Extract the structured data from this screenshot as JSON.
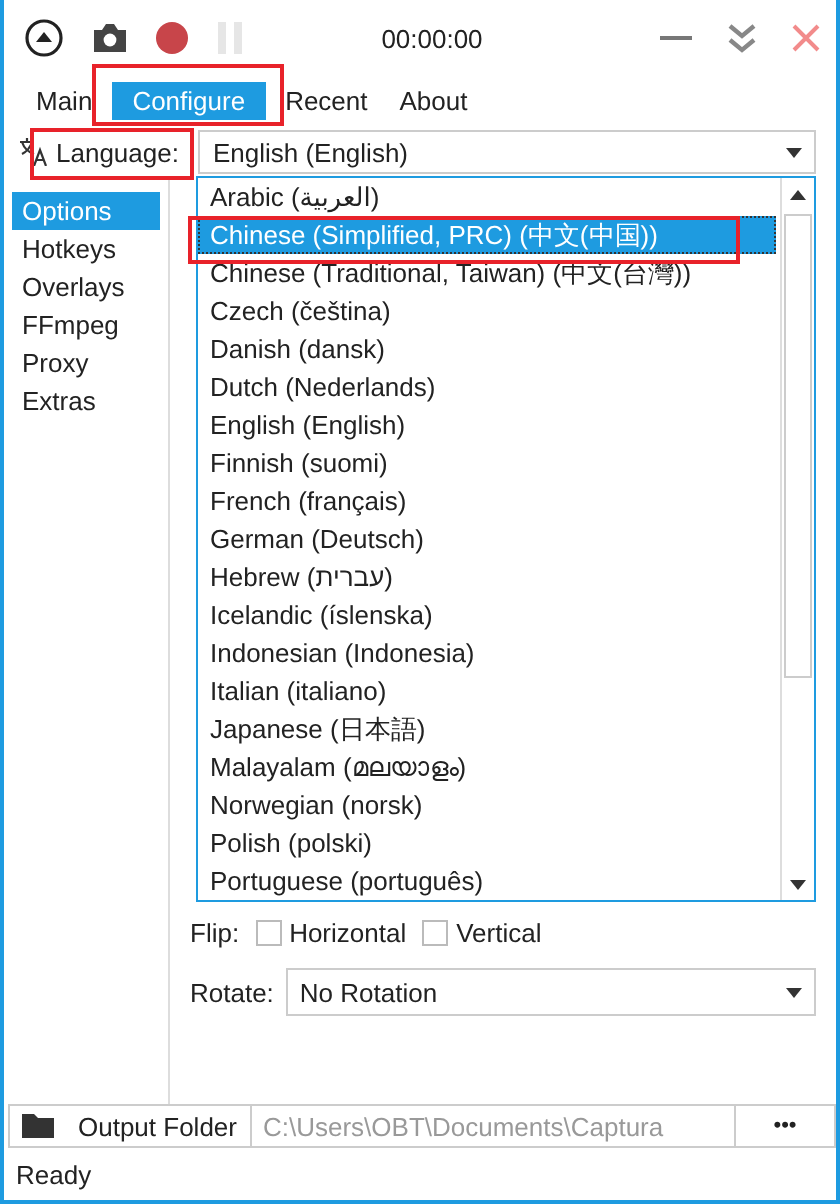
{
  "toolbar": {
    "time": "00:00:00"
  },
  "tabs": [
    {
      "label": "Main",
      "selected": false
    },
    {
      "label": "Configure",
      "selected": true
    },
    {
      "label": "Recent",
      "selected": false
    },
    {
      "label": "About",
      "selected": false
    }
  ],
  "language": {
    "label": "Language:",
    "value": "English (English)",
    "options": [
      {
        "label": "Arabic (العربية)",
        "highlighted": false
      },
      {
        "label": "Chinese (Simplified, PRC) (中文(中国))",
        "highlighted": true
      },
      {
        "label": "Chinese (Traditional, Taiwan) (中文(台灣))",
        "highlighted": false
      },
      {
        "label": "Czech (čeština)",
        "highlighted": false
      },
      {
        "label": "Danish (dansk)",
        "highlighted": false
      },
      {
        "label": "Dutch (Nederlands)",
        "highlighted": false
      },
      {
        "label": "English (English)",
        "highlighted": false
      },
      {
        "label": "Finnish (suomi)",
        "highlighted": false
      },
      {
        "label": "French (français)",
        "highlighted": false
      },
      {
        "label": "German (Deutsch)",
        "highlighted": false
      },
      {
        "label": "Hebrew (עברית)",
        "highlighted": false
      },
      {
        "label": "Icelandic (íslenska)",
        "highlighted": false
      },
      {
        "label": "Indonesian (Indonesia)",
        "highlighted": false
      },
      {
        "label": "Italian (italiano)",
        "highlighted": false
      },
      {
        "label": "Japanese (日本語)",
        "highlighted": false
      },
      {
        "label": "Malayalam (മലയാളം)",
        "highlighted": false
      },
      {
        "label": "Norwegian (norsk)",
        "highlighted": false
      },
      {
        "label": "Polish (polski)",
        "highlighted": false
      },
      {
        "label": "Portuguese (português)",
        "highlighted": false
      }
    ]
  },
  "sidebar": {
    "items": [
      {
        "label": "Options",
        "selected": true
      },
      {
        "label": "Hotkeys",
        "selected": false
      },
      {
        "label": "Overlays",
        "selected": false
      },
      {
        "label": "FFmpeg",
        "selected": false
      },
      {
        "label": "Proxy",
        "selected": false
      },
      {
        "label": "Extras",
        "selected": false
      }
    ]
  },
  "flip": {
    "label": "Flip:",
    "options": [
      {
        "label": "Horizontal",
        "checked": false
      },
      {
        "label": "Vertical",
        "checked": false
      }
    ]
  },
  "rotate": {
    "label": "Rotate:",
    "value": "No Rotation"
  },
  "output": {
    "button": "Output Folder",
    "path": "C:\\Users\\OBT\\Documents\\Captura",
    "more": "•••"
  },
  "status_bar": {
    "text": "Ready"
  }
}
